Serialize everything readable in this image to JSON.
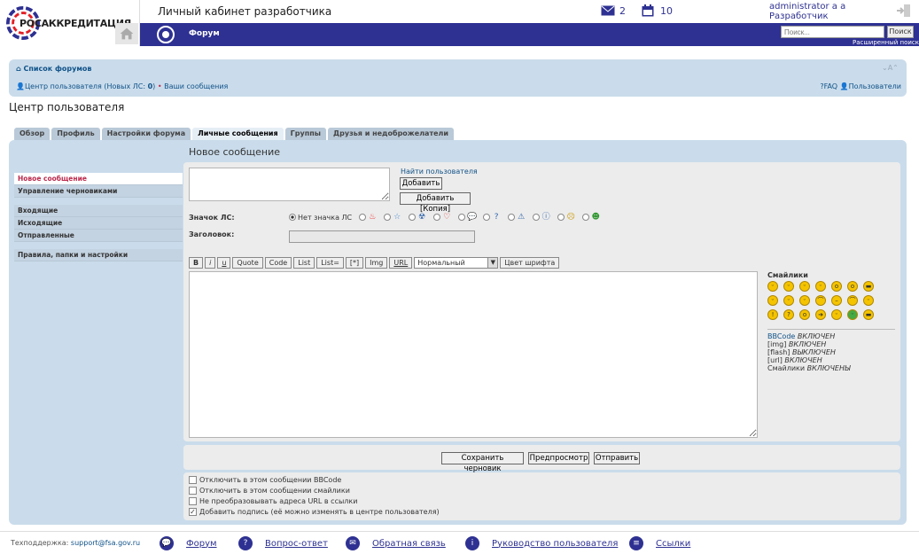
{
  "header": {
    "logo_text": "РОСАККРЕДИТАЦИЯ",
    "portal_title": "Личный кабинет разработчика",
    "messages_count": "2",
    "calendar_count": "10",
    "user_name": "administrator a a",
    "user_role": "Разработчик",
    "nav_forum": "Форум",
    "search_placeholder": "Поиск...",
    "search_button": "Поиск",
    "advanced_search": "Расширенный поиск"
  },
  "forum": {
    "list_label": "Список форумов",
    "breadcrumb_ucp": "Центр пользователя (Новых ЛС: ",
    "breadcrumb_count": "0",
    "breadcrumb_end": ")",
    "breadcrumb_sep": "•",
    "breadcrumb_msgs": "Ваши сообщения",
    "faq": "FAQ",
    "users": "Пользователи"
  },
  "page_title": "Центр пользователя",
  "tabs": [
    "Обзор",
    "Профиль",
    "Настройки форума",
    "Личные сообщения",
    "Группы",
    "Друзья и недоброжелатели"
  ],
  "sidebar": {
    "items": [
      "Новое сообщение",
      "Управление черновиками",
      "Входящие",
      "Исходящие",
      "Отправленные",
      "Правила, папки и настройки"
    ]
  },
  "compose": {
    "title": "Новое сообщение",
    "find_user": "Найти пользователя",
    "add": "Добавить",
    "add_copy": "Добавить [Копия]",
    "icon_label": "Значок ЛС:",
    "no_icon": "Нет значка ЛС",
    "subject_label": "Заголовок:",
    "subject_value": "",
    "message_value": ""
  },
  "format_buttons": [
    "B",
    "i",
    "u",
    "Quote",
    "Code",
    "List",
    "List=",
    "[*]",
    "Img",
    "URL"
  ],
  "font_size": "Нормальный",
  "font_color": "Цвет шрифта",
  "smilies": {
    "title": "Смайлики",
    "status": [
      {
        "tag": "BBCode",
        "state": "ВКЛЮЧЕН"
      },
      {
        "tag": "[img]",
        "state": "ВКЛЮЧЕН"
      },
      {
        "tag": "[flash]",
        "state": "ВЫКЛЮЧЕН"
      },
      {
        "tag": "[url]",
        "state": "ВКЛЮЧЕН"
      },
      {
        "tag": "Смайлики",
        "state": "ВКЛЮЧЕНЫ"
      }
    ]
  },
  "actions": {
    "save_draft": "Сохранить черновик",
    "preview": "Предпросмотр",
    "submit": "Отправить"
  },
  "options": [
    {
      "label": "Отключить в этом сообщении BBCode",
      "checked": false
    },
    {
      "label": "Отключить в этом сообщении смайлики",
      "checked": false
    },
    {
      "label": "Не преобразовывать адреса URL в ссылки",
      "checked": false
    },
    {
      "label": "Добавить подпись (её можно изменять в центре пользователя)",
      "checked": true
    }
  ],
  "footer": {
    "support_label": "Техподдержка:",
    "support_email": "support@fsa.gov.ru",
    "links": [
      "Форум",
      "Вопрос-ответ",
      "Обратная связь",
      "Руководство пользователя",
      "Ссылки"
    ]
  },
  "colors": {
    "brand": "#2e3192",
    "panel": "#cadceb",
    "link": "#105289",
    "active_side": "#bc2a4d"
  }
}
